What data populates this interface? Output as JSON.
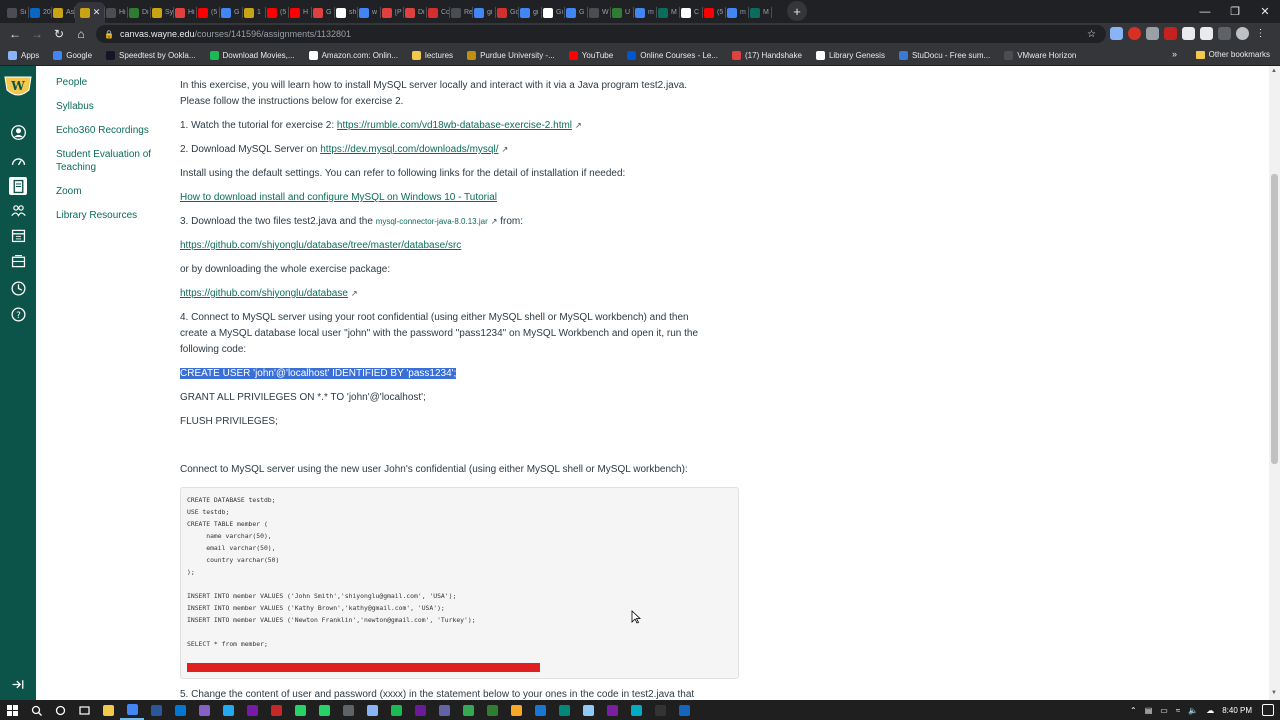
{
  "browser": {
    "tabs": [
      {
        "label": "Si",
        "color": "#4a4d51"
      },
      {
        "label": "20",
        "color": "#0a66c2"
      },
      {
        "label": "As",
        "color": "#c8a415"
      },
      {
        "label": "",
        "color": "#c8a415",
        "active": true
      },
      {
        "label": "Hi",
        "color": "#4a4d51"
      },
      {
        "label": "Di",
        "color": "#2e7d32"
      },
      {
        "label": "Sy",
        "color": "#c8a415"
      },
      {
        "label": "Hi",
        "color": "#e04040"
      },
      {
        "label": "(5",
        "color": "#ff0000"
      },
      {
        "label": "G",
        "color": "#4285f4"
      },
      {
        "label": "1",
        "color": "#c8a415"
      },
      {
        "label": "(5",
        "color": "#ff0000"
      },
      {
        "label": "H",
        "color": "#ff0000"
      },
      {
        "label": "G",
        "color": "#e04040"
      },
      {
        "label": "sh",
        "color": "#ffffff"
      },
      {
        "label": "w",
        "color": "#4285f4"
      },
      {
        "label": "[P",
        "color": "#e04040"
      },
      {
        "label": "Di",
        "color": "#e04040"
      },
      {
        "label": "Cc",
        "color": "#d32f2f"
      },
      {
        "label": "Re",
        "color": "#4a4d51"
      },
      {
        "label": "gi",
        "color": "#4285f4"
      },
      {
        "label": "Go",
        "color": "#d32f2f"
      },
      {
        "label": "gi",
        "color": "#4285f4"
      },
      {
        "label": "Gi",
        "color": "#ffffff"
      },
      {
        "label": "G",
        "color": "#4285f4"
      },
      {
        "label": "W",
        "color": "#4a4d51"
      },
      {
        "label": "U",
        "color": "#2e7d32"
      },
      {
        "label": "m",
        "color": "#4285f4"
      },
      {
        "label": "M",
        "color": "#0b6c5c"
      },
      {
        "label": "C",
        "color": "#ffffff"
      },
      {
        "label": "(5",
        "color": "#ff0000"
      },
      {
        "label": "m",
        "color": "#4285f4"
      },
      {
        "label": "M",
        "color": "#0b6c5c"
      }
    ],
    "tab_close": "✕",
    "new_tab": "+",
    "url_host": "canvas.wayne.edu",
    "url_path": "/courses/141596/assignments/1132801",
    "bookmarks": [
      {
        "label": "Apps",
        "color": "#8ab4f8"
      },
      {
        "label": "Google",
        "color": "#4285f4"
      },
      {
        "label": "Speedtest by Ookla...",
        "color": "#141526"
      },
      {
        "label": "Download Movies,...",
        "color": "#1db954"
      },
      {
        "label": "Amazon.com: Onlin...",
        "color": "#ffffff"
      },
      {
        "label": "lectures",
        "color": "#f2c94c"
      },
      {
        "label": "Purdue University -...",
        "color": "#c28e0e"
      },
      {
        "label": "YouTube",
        "color": "#ff0000"
      },
      {
        "label": "Online Courses - Le...",
        "color": "#0056d2"
      },
      {
        "label": "(17) Handshake",
        "color": "#e04040"
      },
      {
        "label": "Library Genesis",
        "color": "#ffffff"
      },
      {
        "label": "StuDocu - Free sum...",
        "color": "#3c78d8"
      },
      {
        "label": "VMware Horizon",
        "color": "#4a4d51"
      }
    ],
    "other_bookmarks": "Other bookmarks"
  },
  "course_nav": [
    "People",
    "Syllabus",
    "Echo360 Recordings",
    "Student Evaluation of Teaching",
    "Zoom",
    "Library Resources"
  ],
  "content": {
    "intro_1": "In this exercise, you will learn how to install MySQL server locally and interact with it via a Java program test2.java.",
    "intro_2": "Please follow the instructions below for exercise 2.",
    "step1_text": "1. Watch the tutorial for exercise 2: ",
    "step1_link": "https://rumble.com/vd18wb-database-exercise-2.html",
    "step2_text": "2. Download MySQL Server on ",
    "step2_link": "https://dev.mysql.com/downloads/mysql/",
    "install_text": "Install using the default settings. You can refer to following links for the detail of installation if needed:",
    "install_link": "How to download install and configure MySQL on Windows 10 - Tutorial",
    "step3_text": "3. Download the two files test2.java and the ",
    "step3_file": "mysql-connector-java-8.0.13.jar",
    "step3_from": " from:",
    "step3_link": "https://github.com/shiyonglu/database/tree/master/database/src",
    "or_text": "or by downloading the whole exercise package:",
    "package_link": "https://github.com/shiyonglu/database",
    "step4_line1": "4. Connect to MySQL server using your root confidential (using either MySQL shell or MySQL workbench) and then",
    "step4_line2": "create a MySQL database local user \"john\" with the password \"pass1234\" on MySQL Workbench and open it, run the",
    "step4_line3": "following code:",
    "sql_create_user": "CREATE USER 'john'@'localhost' IDENTIFIED BY 'pass1234';",
    "sql_grant": "GRANT ALL PRIVILEGES ON *.* TO 'john'@'localhost';",
    "sql_flush": "FLUSH PRIVILEGES;",
    "connect_text": "Connect to MySQL server using the new user John's confidential (using either MySQL shell or MySQL workbench):",
    "code_lines": [
      "CREATE DATABASE testdb;",
      "USE testdb;",
      "CREATE TABLE member (",
      "     name varchar(50),",
      "     email varchar(50),",
      "     country varchar(50)",
      ");",
      "",
      "INSERT INTO member VALUES ('John Smith','shiyonglu@gmail.com', 'USA');",
      "INSERT INTO member VALUES ('Kathy Brown','kathy@gmail.com', 'USA');",
      "INSERT INTO member VALUES ('Newton Franklin','newton@gmail.com', 'Turkey');",
      "",
      "SELECT * from member;"
    ],
    "step5_text": "5. Change the content of user and password (xxxx) in the statement below to your ones in the code in test2.java that"
  },
  "taskbar": {
    "apps": [
      {
        "name": "file-explorer",
        "color": "#f2c94c"
      },
      {
        "name": "chrome",
        "color": "#4285f4",
        "running": true
      },
      {
        "name": "word",
        "color": "#2b579a"
      },
      {
        "name": "outlook",
        "color": "#0078d4"
      },
      {
        "name": "visual-studio",
        "color": "#8661c5"
      },
      {
        "name": "vscode",
        "color": "#23a9f2"
      },
      {
        "name": "onenote",
        "color": "#7719aa"
      },
      {
        "name": "app-red",
        "color": "#c62828"
      },
      {
        "name": "whatsapp",
        "color": "#25d366"
      },
      {
        "name": "whatsapp-2",
        "color": "#25d366"
      },
      {
        "name": "app-gray",
        "color": "#5f6368"
      },
      {
        "name": "pen-tool",
        "color": "#8ab4f8"
      },
      {
        "name": "spotify",
        "color": "#1db954"
      },
      {
        "name": "app-purple",
        "color": "#6a1b9a"
      },
      {
        "name": "teams",
        "color": "#6264a7"
      },
      {
        "name": "maps",
        "color": "#34a853"
      },
      {
        "name": "app-green",
        "color": "#2e7d32"
      },
      {
        "name": "app-yellow",
        "color": "#f9a825"
      },
      {
        "name": "app-blue",
        "color": "#1976d2"
      },
      {
        "name": "app-teal",
        "color": "#00897b"
      },
      {
        "name": "app-lightblue",
        "color": "#90caf9"
      },
      {
        "name": "app-violet",
        "color": "#7b1fa2"
      },
      {
        "name": "app-cyan",
        "color": "#00acc1"
      },
      {
        "name": "terminal",
        "color": "#333333"
      },
      {
        "name": "app-navy",
        "color": "#1565c0"
      }
    ],
    "time": "8:40 PM"
  },
  "colors": {
    "canvas_nav": "#0c5449",
    "link": "#0b6c5c",
    "selection": "#3a6fd8",
    "error_bar": "#e02020"
  }
}
